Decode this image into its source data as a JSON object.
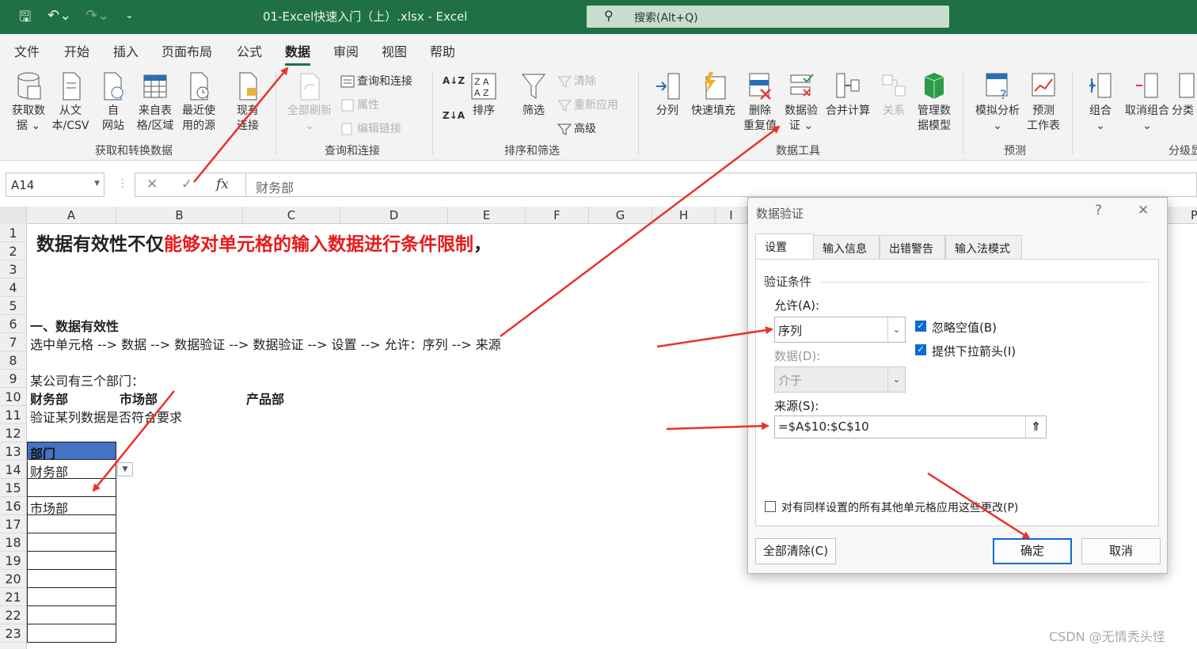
{
  "window": {
    "title": "01-Excel快速入门（上）.xlsx  -  Excel",
    "search_placeholder": "搜索(Alt+Q)"
  },
  "menu": [
    "文件",
    "开始",
    "插入",
    "页面布局",
    "公式",
    "数据",
    "审阅",
    "视图",
    "帮助"
  ],
  "ribbon": {
    "get_data": "获取数\n据 ⌄",
    "from_csv": "从文\n本/CSV",
    "from_web": "自\n网站",
    "from_table": "来自表\n格/区域",
    "recent_sources": "最近使\n用的源",
    "existing_conn": "现有\n连接",
    "refresh_all": "全部刷新\n⌄",
    "queries_connections": "查询和连接",
    "properties": "属性",
    "edit_links": "编辑链接",
    "sort_az": "A↓Z",
    "sort_za": "Z↓A",
    "sort": "排序",
    "filter": "筛选",
    "clear": "清除",
    "reapply": "重新应用",
    "advanced": "高级",
    "text_to_columns": "分列",
    "flash_fill": "快速填充",
    "remove_duplicates": "删除\n重复值",
    "data_validation": "数据验\n证 ⌄",
    "consolidate": "合并计算",
    "relationships": "关系",
    "data_model": "管理数\n据模型",
    "what_if": "模拟分析\n⌄",
    "forecast_sheet": "预测\n工作表",
    "group": "组合\n⌄",
    "ungroup": "取消组合\n⌄",
    "subtotal": "分类",
    "groups": {
      "get_transform": "获取和转换数据",
      "queries": "查询和连接",
      "sort_filter": "排序和筛选",
      "data_tools": "数据工具",
      "forecast": "预测",
      "outline": "分级显"
    }
  },
  "formula_bar": {
    "name_box": "A14",
    "cancel": "✕",
    "enter": "✓",
    "fx": "fx",
    "content": "财务部"
  },
  "columns": [
    "A",
    "B",
    "C",
    "D",
    "E",
    "F",
    "G",
    "H",
    "I",
    "P"
  ],
  "rows": [
    "1",
    "2",
    "3",
    "4",
    "5",
    "6",
    "7",
    "8",
    "9",
    "10",
    "11",
    "12",
    "13",
    "14",
    "15",
    "16",
    "17",
    "18",
    "19",
    "20",
    "21",
    "22",
    "23"
  ],
  "sheet": {
    "heading_black": "数据有效性不仅",
    "heading_red": "能够对单元格的输入数据进行条件限制",
    "heading_comma": "，",
    "section": "一、数据有效性",
    "steps": "选中单元格 --> 数据 --> 数据验证 --> 数据验证 --> 设置 --> 允许：序列 --> 来源",
    "intro": "某公司有三个部门：",
    "dept1": "财务部",
    "dept2": "市场部",
    "dept3": "产品部",
    "check_req": "验证某列数据是否符合要求",
    "table_header": "部门",
    "a14": "财务部",
    "a16": "市场部",
    "header_color": "#4472c4"
  },
  "dialog": {
    "title": "数据验证",
    "help": "?",
    "close": "✕",
    "tabs": [
      "设置",
      "输入信息",
      "出错警告",
      "输入法模式"
    ],
    "criteria": "验证条件",
    "allow_label": "允许(A):",
    "allow_value": "序列",
    "ignore_blank": "忽略空值(B)",
    "dropdown_arrow": "提供下拉箭头(I)",
    "data_label": "数据(D):",
    "data_value": "介于",
    "source_label": "来源(S):",
    "source_value": "=$A$10:$C$10",
    "apply_all": "对有同样设置的所有其他单元格应用这些更改(P)",
    "clear_all": "全部清除(C)",
    "ok": "确定",
    "cancel": "取消"
  },
  "watermark": "CSDN @无情秃头怪",
  "colors": {
    "accent": "#1f7145",
    "arrow": "#e8322c",
    "link_blue": "#0b6bd1"
  }
}
